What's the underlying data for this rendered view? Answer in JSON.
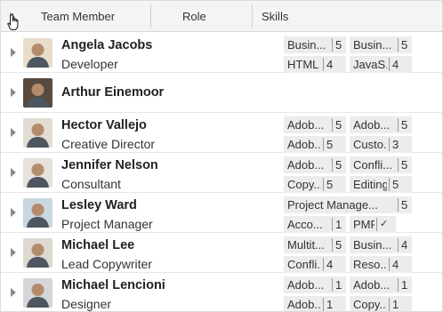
{
  "header": {
    "columns": [
      "Team Member",
      "Role",
      "Skills"
    ]
  },
  "rows": [
    {
      "name": "Angela Jacobs",
      "role": "Developer",
      "avatar_color": "#e9dccb",
      "skills": [
        {
          "name": "Busin...",
          "value": "5"
        },
        {
          "name": "Busin...",
          "value": "5"
        },
        {
          "name": "HTML",
          "value": "4"
        },
        {
          "name": "JavaS...",
          "value": "4"
        }
      ]
    },
    {
      "name": "Arthur Einemoor",
      "role": "",
      "avatar_color": "#5a4a3e",
      "skills": []
    },
    {
      "name": "Hector Vallejo",
      "role": "Creative Director",
      "avatar_color": "#e2dcd3",
      "skills": [
        {
          "name": "Adob...",
          "value": "5"
        },
        {
          "name": "Adob...",
          "value": "5"
        },
        {
          "name": "Adob...",
          "value": "5"
        },
        {
          "name": "Custo...",
          "value": "3"
        }
      ]
    },
    {
      "name": "Jennifer Nelson",
      "role": "Consultant",
      "avatar_color": "#e6e1da",
      "skills": [
        {
          "name": "Adob...",
          "value": "5"
        },
        {
          "name": "Confli...",
          "value": "5"
        },
        {
          "name": "Copy...",
          "value": "5"
        },
        {
          "name": "Editing",
          "value": "5"
        }
      ]
    },
    {
      "name": "Lesley Ward",
      "role": "Project Manager",
      "avatar_color": "#c9d7e0",
      "skills": [
        {
          "name": "Project Manage...",
          "value": "5"
        },
        {
          "name": "Acco...",
          "value": "1"
        },
        {
          "name": "PMP",
          "value": "✓"
        }
      ]
    },
    {
      "name": "Michael Lee",
      "role": "Lead Copywriter",
      "avatar_color": "#ddd8d0",
      "skills": [
        {
          "name": "Multit...",
          "value": "5"
        },
        {
          "name": "Busin...",
          "value": "4"
        },
        {
          "name": "Confli...",
          "value": "4"
        },
        {
          "name": "Reso...",
          "value": "4"
        }
      ]
    },
    {
      "name": "Michael Lencioni",
      "role": "Designer",
      "avatar_color": "#d4d6d8",
      "skills": [
        {
          "name": "Adob...",
          "value": "1"
        },
        {
          "name": "Adob...",
          "value": "1"
        },
        {
          "name": "Adob...",
          "value": "1"
        },
        {
          "name": "Copy...",
          "value": "1"
        }
      ]
    }
  ]
}
